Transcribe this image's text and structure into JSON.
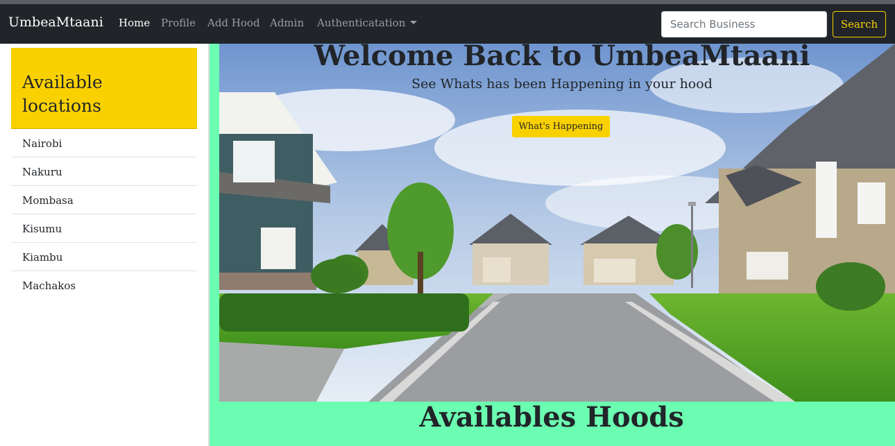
{
  "navbar": {
    "brand": "UmbeaMtaani",
    "links": [
      "Home",
      "Profile",
      "Add Hood",
      "Admin",
      "Authenticatation"
    ],
    "search_placeholder": "Search Business",
    "search_label": "Search"
  },
  "sidebar": {
    "title": "Available locations",
    "locations": [
      "Nairobi",
      "Nakuru",
      "Mombasa",
      "Kisumu",
      "Kiambu",
      "Machakos"
    ]
  },
  "hero": {
    "title": "Welcome Back to UmbeaMtaani",
    "subtitle": "See Whats has been Happening in your hood",
    "button_label": "What's Happening"
  },
  "section": {
    "title": "Availables Hoods"
  },
  "colors": {
    "navbar_bg": "#212529",
    "accent_yellow": "#f9d101",
    "main_bg": "#6bfdb1"
  }
}
